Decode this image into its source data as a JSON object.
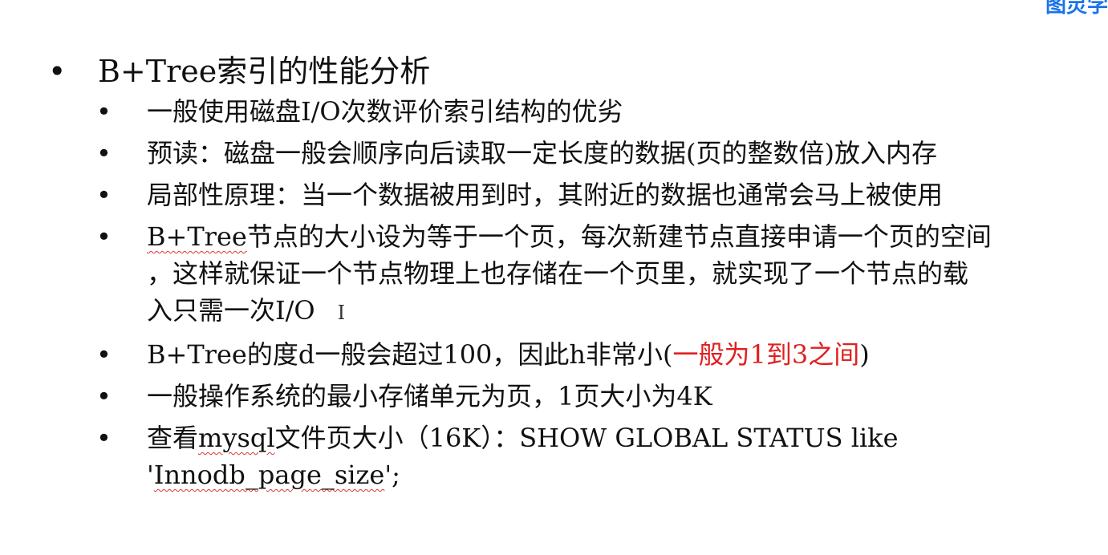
{
  "logo_text": "图灵学",
  "title": "B+Tree索引的性能分析",
  "bullets": [
    {
      "lines": [
        "一般使用磁盘I/O次数评价索引结构的优劣"
      ]
    },
    {
      "lines": [
        "预读：磁盘一般会顺序向后读取一定长度的数据(页的整数倍)放入内存"
      ]
    },
    {
      "lines": [
        "局部性原理：当一个数据被用到时，其附近的数据也通常会马上被使用"
      ]
    },
    {
      "prefix": "B+Tree",
      "lines": [
        "节点的大小设为等于一个页，每次新建节点直接申请一个页的空间",
        "，这样就保证一个节点物理上也存储在一个页里，就实现了一个节点的载",
        "入只需一次I/O"
      ],
      "cursor": "I"
    },
    {
      "text": "B+Tree的度d一般会超过100，因此h非常小(",
      "red": "一般为1到3之间",
      "suffix": ")"
    },
    {
      "lines": [
        "一般操作系统的最小存储单元为页，1页大小为4K"
      ]
    },
    {
      "text": "查看",
      "sq1": "mysql",
      "text2": "文件页大小（16K）：SHOW GLOBAL STATUS like",
      "line2_q": "'",
      "sq2": "Innodb_page_size",
      "line2_end": "';"
    }
  ],
  "colors": {
    "highlight": "#e02020",
    "logo": "#1a73e8"
  }
}
